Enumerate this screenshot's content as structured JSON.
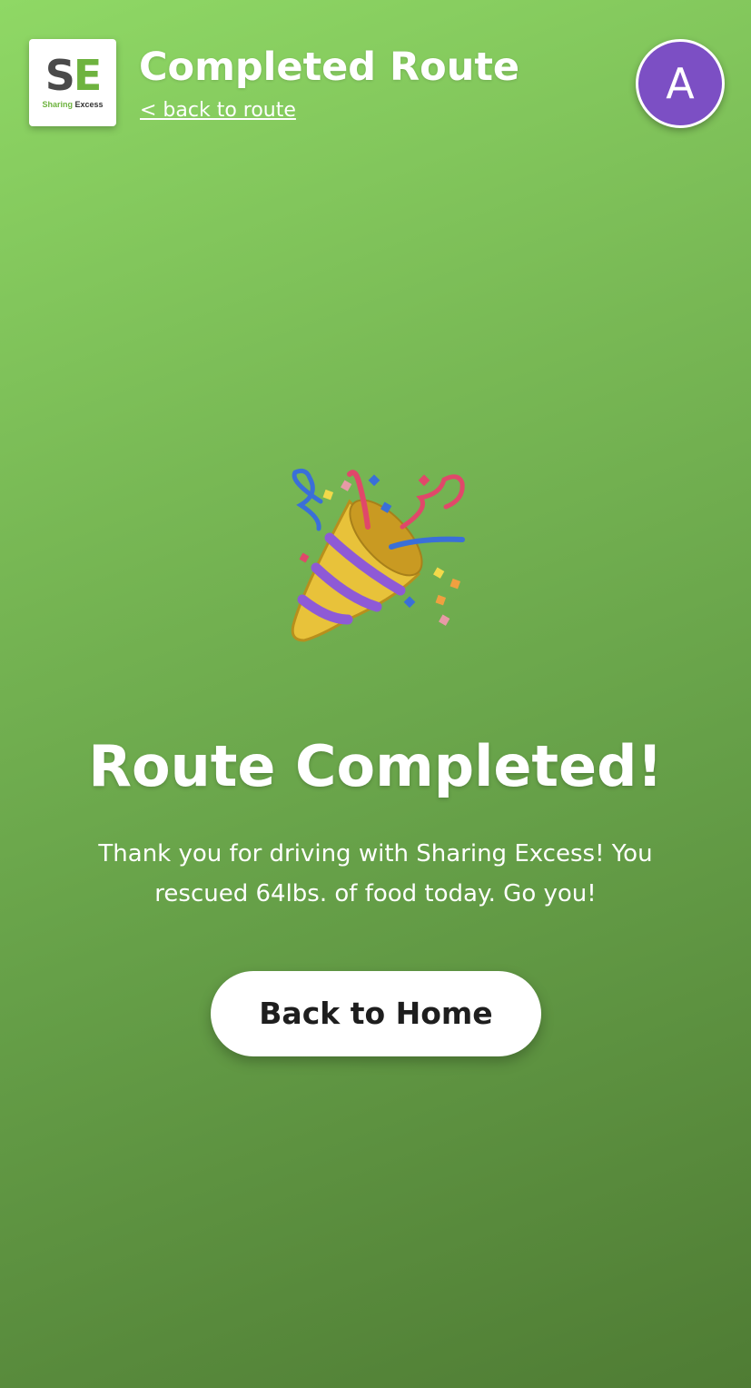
{
  "header": {
    "logo": {
      "letter_s": "S",
      "letter_e": "E",
      "caption_part1": "Sharing",
      "caption_part2": "Excess",
      "brand_green": "#6eb33f",
      "brand_dark": "#4a4a4a"
    },
    "title": "Completed Route",
    "back_link": "< back to route",
    "avatar_initial": "A",
    "avatar_color": "#7c4fc4"
  },
  "main": {
    "icon": "party-popper-icon",
    "headline": "Route Completed!",
    "message": "Thank you for driving with Sharing Excess! You rescued 64lbs. of food today. Go you!",
    "home_button": "Back to Home"
  },
  "colors": {
    "background_top": "#8fd865",
    "background_bottom": "#4f7c34",
    "button_text": "#1e1e1e"
  }
}
